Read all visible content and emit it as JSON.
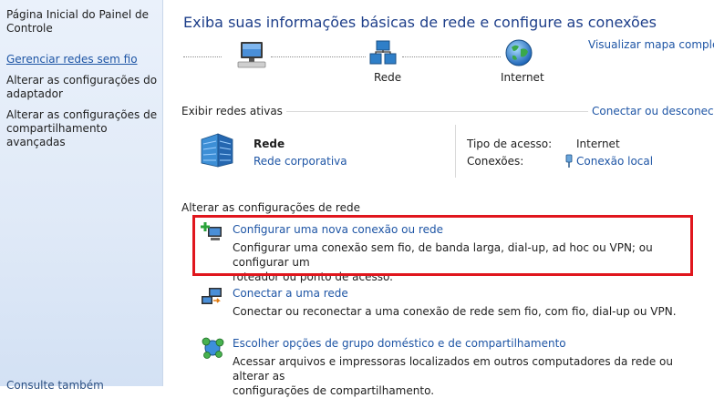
{
  "sidebar": {
    "items": [
      {
        "label": "Página Inicial do Painel de Controle"
      },
      {
        "label": "Gerenciar redes sem fio"
      },
      {
        "label": "Alterar as configurações do adaptador"
      },
      {
        "label": "Alterar as configurações de compartilhamento avançadas"
      }
    ],
    "footer_partial": "Consulte também"
  },
  "header": {
    "title": "Exiba suas informações básicas de rede e configure as conexões",
    "view_map_link": "Visualizar mapa completo"
  },
  "network_map": {
    "computer_label": "",
    "network_label": "Rede",
    "internet_label": "Internet"
  },
  "active_networks": {
    "heading": "Exibir redes ativas",
    "connect_link": "Conectar ou desconectar",
    "network_name": "Rede",
    "network_type": "Rede corporativa",
    "access_type_label": "Tipo de acesso:",
    "access_type_value": "Internet",
    "connections_label": "Conexões:",
    "connections_value": "Conexão local"
  },
  "change_settings": {
    "heading": "Alterar as configurações de rede",
    "tasks": [
      {
        "title": "Configurar uma nova conexão ou rede",
        "desc_line1": "Configurar uma conexão sem fio, de banda larga, dial-up, ad hoc ou VPN; ou configurar um",
        "desc_line2": "roteador ou ponto de acesso."
      },
      {
        "title": "Conectar a uma rede",
        "desc_line1": "Conectar ou reconectar a uma conexão de rede sem fio, com fio, dial-up ou VPN."
      },
      {
        "title": "Escolher opções de grupo doméstico e de compartilhamento",
        "desc_line1": "Acessar arquivos e impressoras localizados em outros computadores da rede ou alterar as",
        "desc_line2": "configurações de compartilhamento."
      }
    ]
  },
  "colors": {
    "link": "#1e55a5",
    "title": "#1e3f8a",
    "highlight": "#e0161d",
    "sidebar_bg": "#dfe9f7"
  }
}
